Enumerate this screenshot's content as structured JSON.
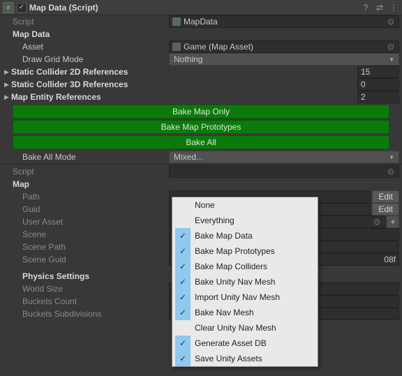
{
  "component1": {
    "title": "Map Data (Script)",
    "enabled_check": "✓",
    "script_row": {
      "label": "Script",
      "value": "MapData"
    },
    "section": "Map Data",
    "asset": {
      "label": "Asset",
      "value": "Game (Map Asset)"
    },
    "draw_grid": {
      "label": "Draw Grid Mode",
      "value": "Nothing"
    },
    "foldouts": [
      {
        "label": "Static Collider 2D References",
        "count": "15"
      },
      {
        "label": "Static Collider 3D References",
        "count": "0"
      },
      {
        "label": "Map Entity References",
        "count": "2"
      }
    ],
    "buttons": {
      "bake_map": "Bake Map Only",
      "bake_proto": "Bake Map Prototypes",
      "bake_all": "Bake All"
    },
    "bake_all_mode": {
      "label": "Bake All Mode",
      "value": "Mixed..."
    }
  },
  "component2": {
    "script_row": {
      "label": "Script",
      "value": ""
    },
    "section": "Map",
    "rows": {
      "path": {
        "label": "Path",
        "value": "",
        "edit": "Edit"
      },
      "guid": {
        "label": "Guid",
        "value": "",
        "edit": "Edit"
      },
      "user_asset": {
        "label": "User Asset",
        "value": ""
      },
      "scene": {
        "label": "Scene",
        "value": ""
      },
      "scene_path": {
        "label": "Scene Path",
        "value": ""
      },
      "scene_guid": {
        "label": "Scene Guid",
        "value": "08f"
      }
    },
    "physics_section": "Physics Settings",
    "physics": {
      "world_size": {
        "label": "World Size"
      },
      "buckets_count": {
        "label": "Buckets Count"
      },
      "buckets_sub": {
        "label": "Buckets Subdivisions"
      }
    }
  },
  "popup": {
    "items": [
      {
        "label": "None",
        "checked": false
      },
      {
        "label": "Everything",
        "checked": false
      },
      {
        "label": "Bake Map Data",
        "checked": true
      },
      {
        "label": "Bake Map Prototypes",
        "checked": true
      },
      {
        "label": "Bake Map Colliders",
        "checked": true
      },
      {
        "label": "Bake Unity Nav Mesh",
        "checked": true
      },
      {
        "label": "Import Unity Nav Mesh",
        "checked": true
      },
      {
        "label": "Bake Nav Mesh",
        "checked": true
      },
      {
        "label": "Clear Unity Nav Mesh",
        "checked": false
      },
      {
        "label": "Generate Asset DB",
        "checked": true
      },
      {
        "label": "Save Unity Assets",
        "checked": true
      }
    ]
  }
}
